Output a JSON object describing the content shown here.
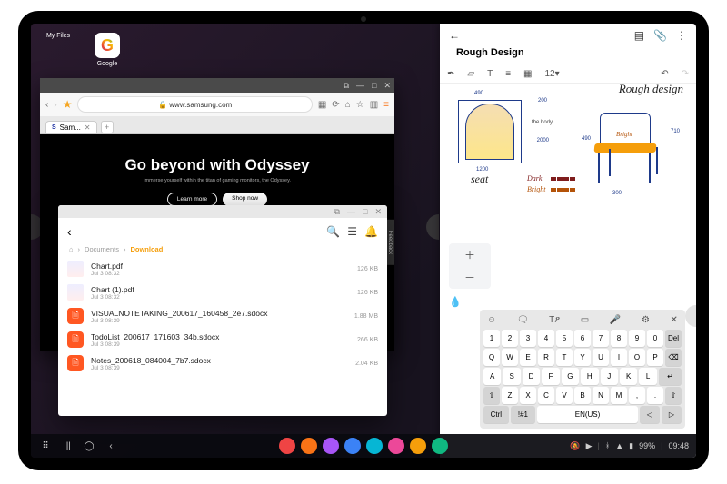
{
  "desktop": {
    "icons": [
      {
        "label": "My Files"
      },
      {
        "label": "Google"
      }
    ]
  },
  "browser": {
    "url": "www.samsung.com",
    "lock_label": "🔒",
    "tab": {
      "label": "Sam..."
    },
    "hero": {
      "headline": "Go beyond with Odyssey",
      "sub": "Immerse yourself within the titan of gaming monitors, the Odyssey.",
      "learn": "Learn more",
      "shop": "Shop now"
    },
    "feedback": "Feedback"
  },
  "files": {
    "crumb_home": "⌂",
    "crumb_docs": "Documents",
    "crumb_cur": "Download",
    "items": [
      {
        "name": "Chart.pdf",
        "date": "Jul 3 08:32",
        "size": "126 KB",
        "type": "pdf"
      },
      {
        "name": "Chart (1).pdf",
        "date": "Jul 3 08:32",
        "size": "126 KB",
        "type": "pdf"
      },
      {
        "name": "VISUALNOTETAKING_200617_160458_2e7.sdocx",
        "date": "Jul 3 08:39",
        "size": "1.88 MB",
        "type": "doc"
      },
      {
        "name": "TodoList_200617_171603_34b.sdocx",
        "date": "Jul 3 08:39",
        "size": "266 KB",
        "type": "doc"
      },
      {
        "name": "Notes_200618_084004_7b7.sdocx",
        "date": "Jul 3 08:39",
        "size": "2.04 KB",
        "type": "doc"
      }
    ]
  },
  "notes": {
    "title": "Rough Design",
    "font_size": "12",
    "hand_title": "Rough design",
    "label_seat": "seat",
    "label_dark": "Dark",
    "label_bright": "Bright",
    "label_bright2": "Bright",
    "dim": {
      "w1": "490",
      "w2": "1200",
      "h1": "200",
      "h2": "2000",
      "chair_w": "490",
      "chair_d": "300",
      "chair_h": "710",
      "label_body": "the body"
    }
  },
  "keyboard": {
    "tool_close": "✕",
    "row_num": [
      "1",
      "2",
      "3",
      "4",
      "5",
      "6",
      "7",
      "8",
      "9",
      "0",
      "Del"
    ],
    "row1": [
      "Q",
      "W",
      "E",
      "R",
      "T",
      "Y",
      "U",
      "I",
      "O",
      "P"
    ],
    "row2": [
      "A",
      "S",
      "D",
      "F",
      "G",
      "H",
      "J",
      "K",
      "L"
    ],
    "row3": [
      "Z",
      "X",
      "C",
      "V",
      "B",
      "N",
      "M"
    ],
    "shift": "⇧",
    "ctrl": "Ctrl",
    "sym": "!#1",
    "space": "EN(US)",
    "back": "⌫",
    "enter": "↵",
    "left": "◁",
    "right": "▷",
    "comma": ",",
    "period": "."
  },
  "taskbar": {
    "apps_colors": [
      "#ef4444",
      "#f97316",
      "#a855f7",
      "#3b82f6",
      "#06b6d4",
      "#ec4899",
      "#f59e0b",
      "#10b981"
    ],
    "battery": "99%",
    "time": "09:48"
  }
}
